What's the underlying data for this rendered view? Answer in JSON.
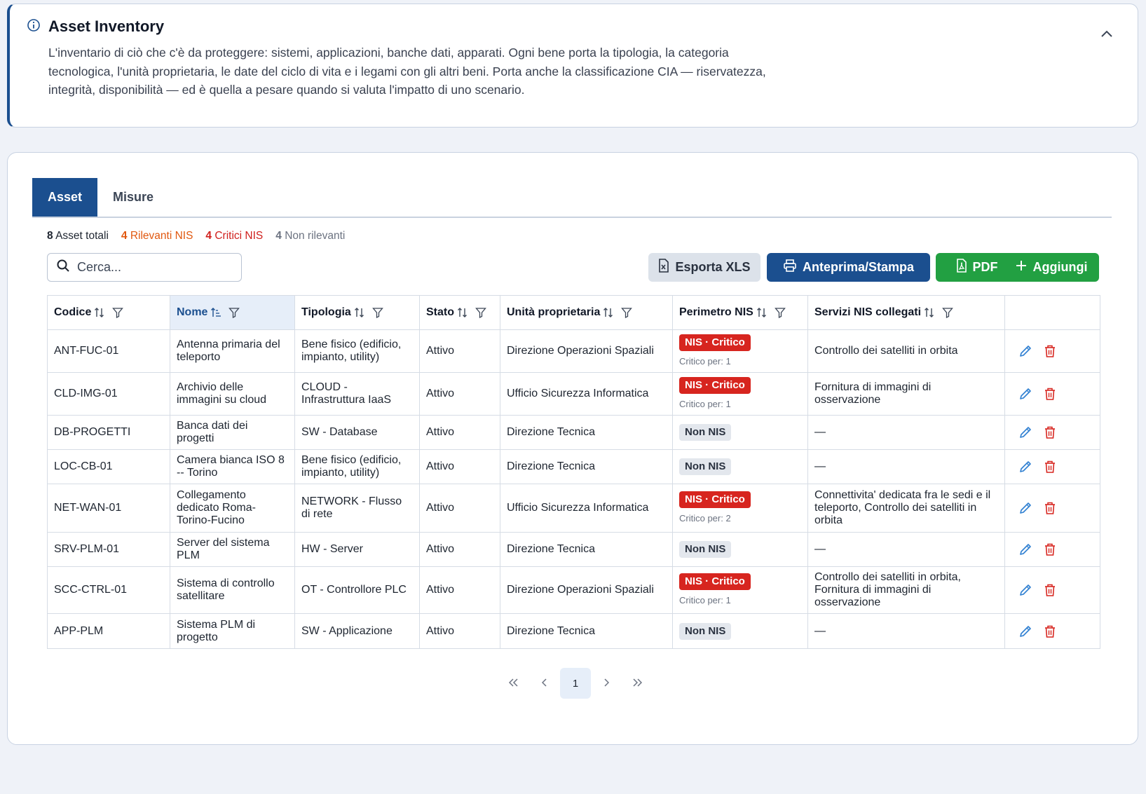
{
  "info": {
    "title": "Asset Inventory",
    "description": "L'inventario di ciò che c'è da proteggere: sistemi, applicazioni, banche dati, apparati. Ogni bene porta la tipologia, la categoria tecnologica, l'unità proprietaria, le date del ciclo di vita e i legami con gli altri beni. Porta anche la classificazione CIA — riservatezza, integrità, disponibilità — ed è quella a pesare quando si valuta l'impatto di uno scenario."
  },
  "tabs": [
    {
      "label": "Asset",
      "active": true
    },
    {
      "label": "Misure",
      "active": false
    }
  ],
  "stats": {
    "total_count": "8",
    "total_label": "Asset totali",
    "rel_count": "4",
    "rel_label": "Rilevanti NIS",
    "crit_count": "4",
    "crit_label": "Critici NIS",
    "non_count": "4",
    "non_label": "Non rilevanti"
  },
  "search": {
    "placeholder": "Cerca..."
  },
  "toolbar": {
    "export_label": "Esporta XLS",
    "print_label": "Anteprima/Stampa",
    "pdf_label": "PDF",
    "add_label": "Aggiungi"
  },
  "table": {
    "columns": [
      "Codice",
      "Nome",
      "Tipologia",
      "Stato",
      "Unità proprietaria",
      "Perimetro NIS",
      "Servizi NIS collegati",
      ""
    ],
    "rows": [
      {
        "codice": "ANT-FUC-01",
        "nome": "Antenna primaria del teleporto",
        "tipologia": "Bene fisico (edificio, impianto, utility)",
        "stato": "Attivo",
        "unita": "Direzione Operazioni Spaziali",
        "nis": "NIS · Critico",
        "nis_critico": true,
        "critico_per": "Critico per: 1",
        "servizi": "Controllo dei satelliti in orbita"
      },
      {
        "codice": "CLD-IMG-01",
        "nome": "Archivio delle immagini su cloud",
        "tipologia": "CLOUD - Infrastruttura IaaS",
        "stato": "Attivo",
        "unita": "Ufficio Sicurezza Informatica",
        "nis": "NIS · Critico",
        "nis_critico": true,
        "critico_per": "Critico per: 1",
        "servizi": "Fornitura di immagini di osservazione"
      },
      {
        "codice": "DB-PROGETTI",
        "nome": "Banca dati dei progetti",
        "tipologia": "SW - Database",
        "stato": "Attivo",
        "unita": "Direzione Tecnica",
        "nis": "Non NIS",
        "nis_critico": false,
        "critico_per": "",
        "servizi": "—"
      },
      {
        "codice": "LOC-CB-01",
        "nome": "Camera bianca ISO 8 -- Torino",
        "tipologia": "Bene fisico (edificio, impianto, utility)",
        "stato": "Attivo",
        "unita": "Direzione Tecnica",
        "nis": "Non NIS",
        "nis_critico": false,
        "critico_per": "",
        "servizi": "—"
      },
      {
        "codice": "NET-WAN-01",
        "nome": "Collegamento dedicato Roma-Torino-Fucino",
        "tipologia": "NETWORK - Flusso di rete",
        "stato": "Attivo",
        "unita": "Ufficio Sicurezza Informatica",
        "nis": "NIS · Critico",
        "nis_critico": true,
        "critico_per": "Critico per: 2",
        "servizi": "Connettivita' dedicata fra le sedi e il teleporto, Controllo dei satelliti in orbita"
      },
      {
        "codice": "SRV-PLM-01",
        "nome": "Server del sistema PLM",
        "tipologia": "HW - Server",
        "stato": "Attivo",
        "unita": "Direzione Tecnica",
        "nis": "Non NIS",
        "nis_critico": false,
        "critico_per": "",
        "servizi": "—"
      },
      {
        "codice": "SCC-CTRL-01",
        "nome": "Sistema di controllo satellitare",
        "tipologia": "OT - Controllore PLC",
        "stato": "Attivo",
        "unita": "Direzione Operazioni Spaziali",
        "nis": "NIS · Critico",
        "nis_critico": true,
        "critico_per": "Critico per: 1",
        "servizi": "Controllo dei satelliti in orbita, Fornitura di immagini di osservazione"
      },
      {
        "codice": "APP-PLM",
        "nome": "Sistema PLM di progetto",
        "tipologia": "SW - Applicazione",
        "stato": "Attivo",
        "unita": "Direzione Tecnica",
        "nis": "Non NIS",
        "nis_critico": false,
        "critico_per": "",
        "servizi": "—"
      }
    ]
  },
  "pagination": {
    "current": "1"
  },
  "colors": {
    "primary": "#1b4f8f",
    "success": "#22a042",
    "danger": "#d7251f",
    "warning": "#e1580f",
    "edit_icon": "#2f7fd1",
    "delete_icon": "#d7251f"
  }
}
